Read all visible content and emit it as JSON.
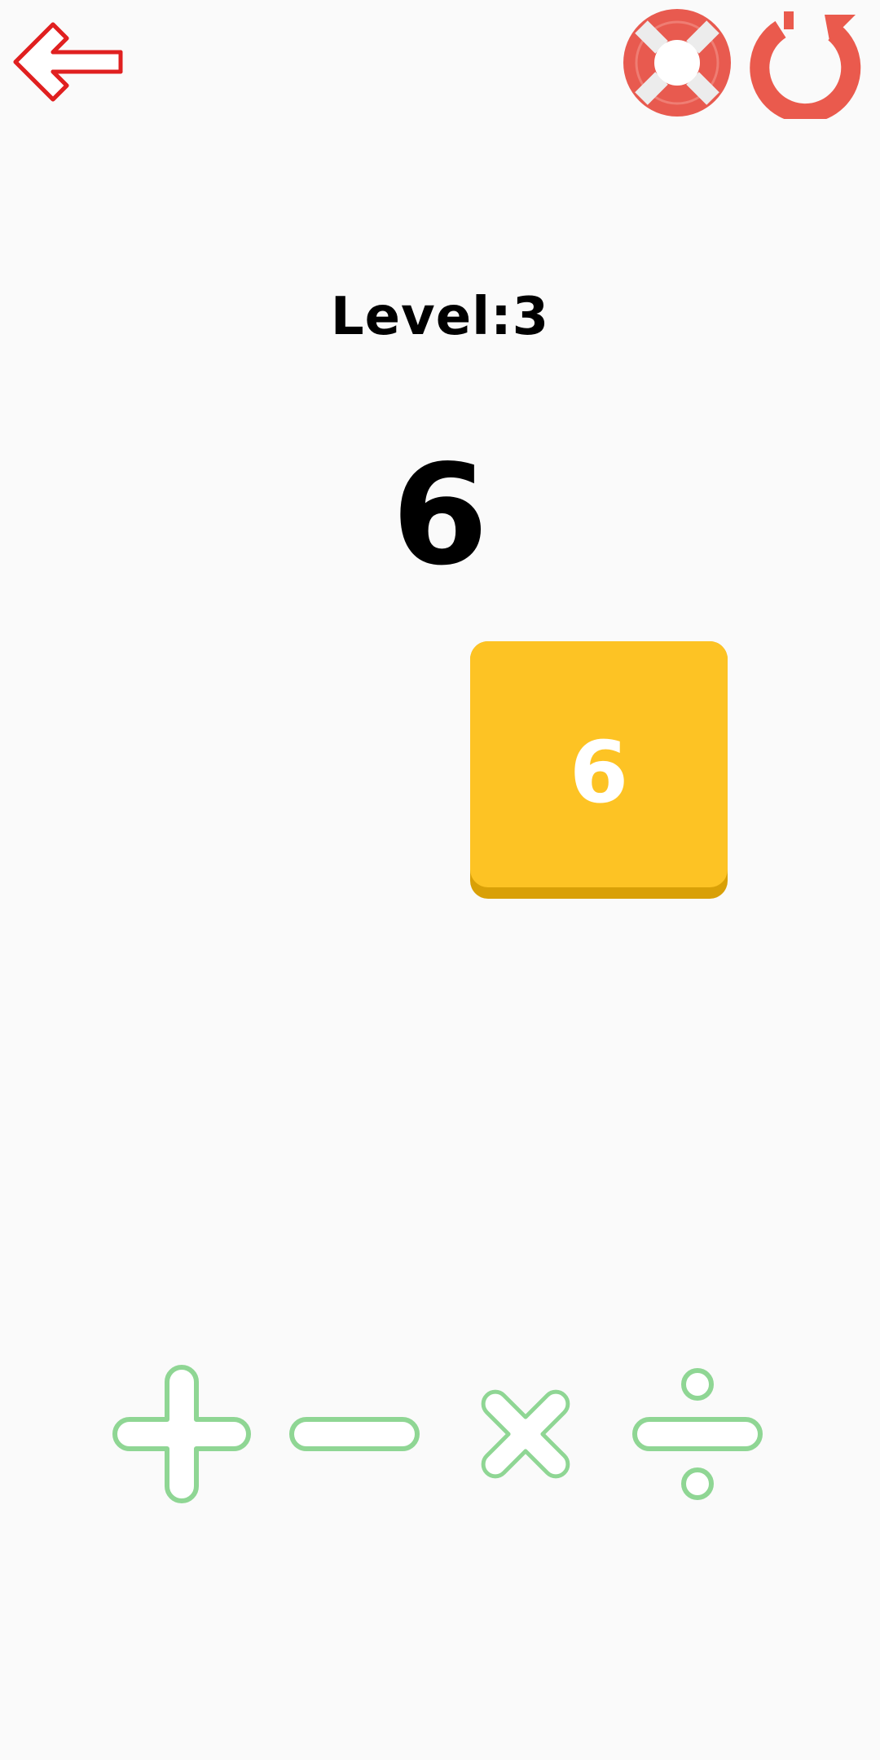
{
  "header": {
    "back_icon": "back-arrow-icon",
    "help_icon": "lifebuoy-icon",
    "restart_icon": "restart-icon",
    "accent_color": "#e53935"
  },
  "game": {
    "level_text": "Level:3",
    "target_value": "6",
    "tiles": [
      {
        "value": "6",
        "color": "#fdc324"
      }
    ]
  },
  "operators": {
    "color": "#8fd694",
    "items": [
      {
        "name": "plus",
        "icon": "plus-icon"
      },
      {
        "name": "minus",
        "icon": "minus-icon"
      },
      {
        "name": "multiply",
        "icon": "multiply-icon"
      },
      {
        "name": "divide",
        "icon": "divide-icon"
      }
    ]
  }
}
